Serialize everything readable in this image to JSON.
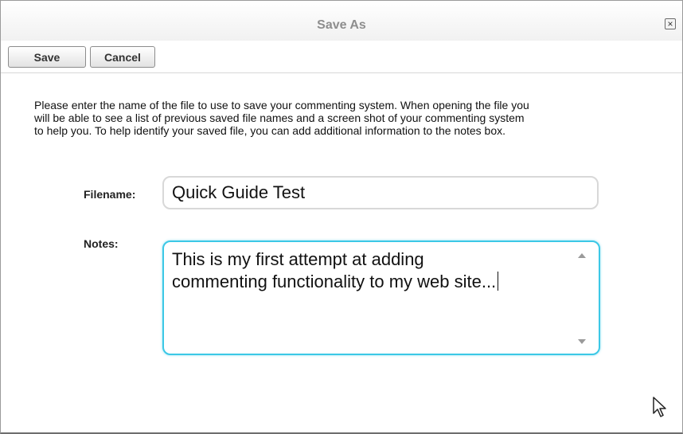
{
  "dialog": {
    "title": "Save As",
    "close_icon": "close-icon"
  },
  "toolbar": {
    "save_label": "Save",
    "cancel_label": "Cancel"
  },
  "description": {
    "lines": [
      "Please enter the name of the file to use to save your commenting system. When opening the file you",
      "will be able to see a list of previous saved file names and a screen shot of your commenting system",
      "to help you. To help identify your saved file, you can add additional information to the notes box."
    ]
  },
  "form": {
    "filename_label": "Filename:",
    "filename_value": "Quick Guide Test",
    "notes_label": "Notes:",
    "notes_lines": [
      "This is my first attempt at adding",
      "commenting functionality to my web site..."
    ]
  },
  "icons": {
    "close": "close-icon",
    "scroll_up": "chevron-up-icon",
    "scroll_down": "chevron-down-icon",
    "cursor": "mouse-pointer-icon"
  },
  "colors": {
    "focus_border": "#3cc8e6",
    "title_text": "#8e8e8e"
  }
}
